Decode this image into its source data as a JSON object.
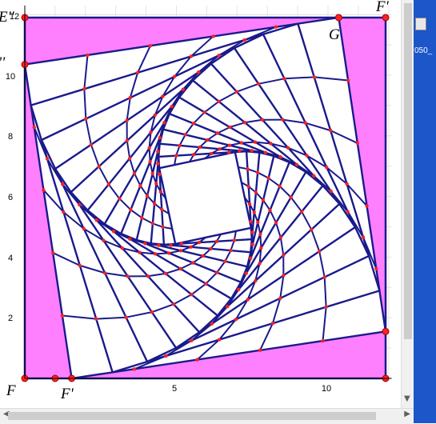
{
  "diagram": {
    "axis": {
      "x_ticks": [
        "5",
        "10"
      ],
      "y_ticks": [
        "2",
        "4",
        "6",
        "8",
        "10",
        "12"
      ]
    },
    "point_labels": {
      "top_left": "E''",
      "top_right": "F'",
      "left_upper": "''",
      "g": "G",
      "bottom_left": "F",
      "bottom_mid": "F'"
    },
    "colors": {
      "fill": "#ff80ff",
      "stroke": "#1a1a8c",
      "point": "#ff2020",
      "grid": "#e4e4e4"
    },
    "shape": {
      "squares": 13,
      "points_per_side": 4
    }
  },
  "side_panel": {
    "text": "050_"
  }
}
